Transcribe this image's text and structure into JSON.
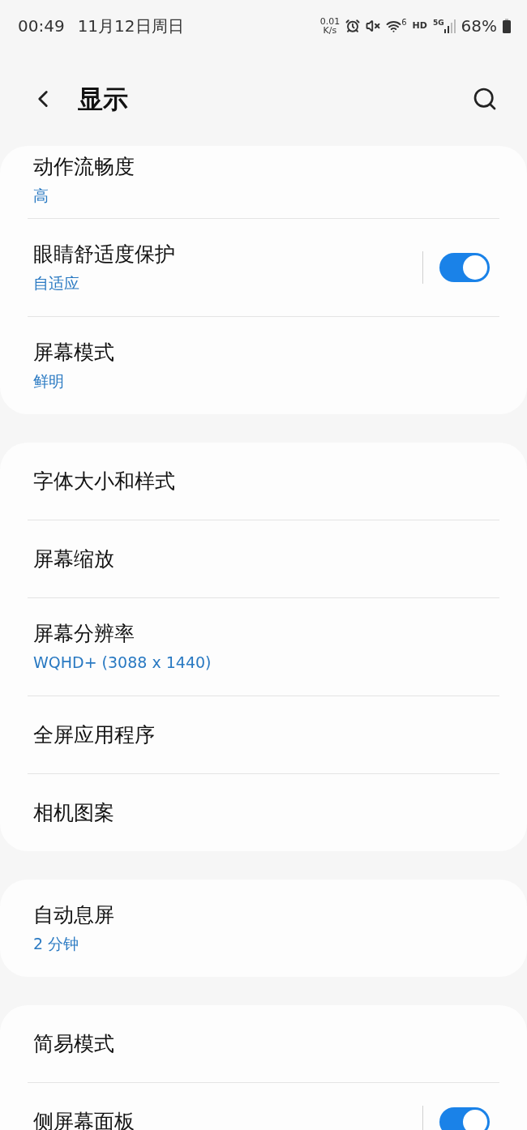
{
  "status_bar": {
    "time": "00:49",
    "date": "11月12日周日",
    "net_speed_value": "0.01",
    "net_speed_unit": "K/s",
    "wifi_badge": "6",
    "hd_label": "HD",
    "network_label": "5G",
    "battery": "68%"
  },
  "header": {
    "title": "显示"
  },
  "groups": [
    {
      "items": [
        {
          "kind": "value",
          "title": "动作流畅度",
          "subtitle": "高"
        },
        {
          "kind": "toggle",
          "title": "眼睛舒适度保护",
          "subtitle": "自适应",
          "on": true
        },
        {
          "kind": "value",
          "title": "屏幕模式",
          "subtitle": "鲜明"
        }
      ]
    },
    {
      "items": [
        {
          "kind": "plain",
          "title": "字体大小和样式"
        },
        {
          "kind": "plain",
          "title": "屏幕缩放"
        },
        {
          "kind": "value",
          "title": "屏幕分辨率",
          "subtitle": "WQHD+ (3088 x 1440)"
        },
        {
          "kind": "plain",
          "title": "全屏应用程序"
        },
        {
          "kind": "plain",
          "title": "相机图案"
        }
      ]
    },
    {
      "items": [
        {
          "kind": "value",
          "title": "自动息屏",
          "subtitle": "2 分钟"
        }
      ]
    },
    {
      "items": [
        {
          "kind": "plain",
          "title": "简易模式"
        },
        {
          "kind": "toggle",
          "title": "侧屏幕面板",
          "on": true
        }
      ]
    }
  ]
}
